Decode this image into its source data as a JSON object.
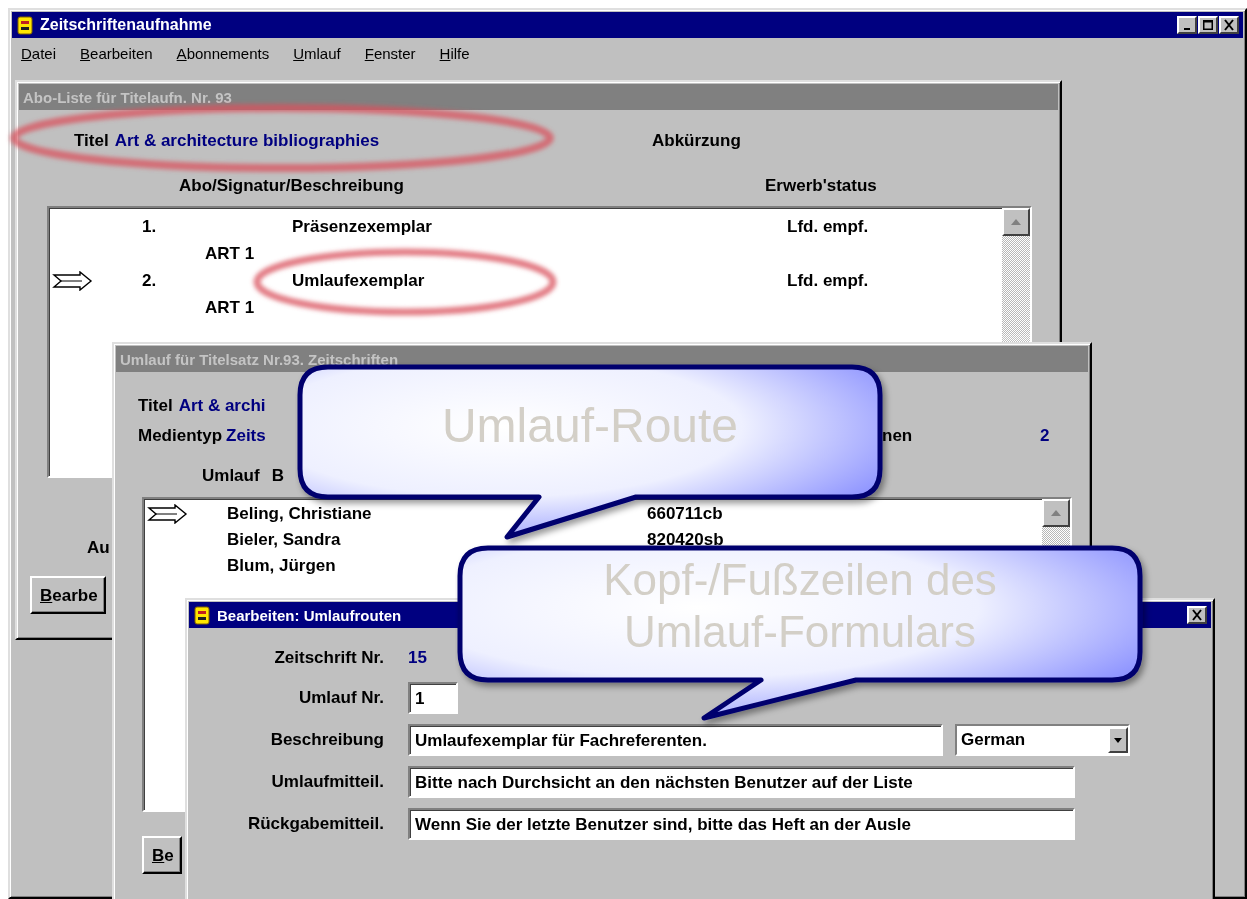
{
  "app": {
    "title": "Zeitschriftenaufnahme",
    "menu": [
      {
        "label": "Datei"
      },
      {
        "label": "Bearbeiten"
      },
      {
        "label": "Abonnements"
      },
      {
        "label": "Umlauf"
      },
      {
        "label": "Fenster"
      },
      {
        "label": "Hilfe"
      }
    ]
  },
  "abo_list_window": {
    "title": "Abo-Liste für Titelaufn. Nr. 93",
    "active": false,
    "title_label": "Titel",
    "title_value": "Art & architecture bibliographies",
    "abbreviation_label": "Abkürzung",
    "columns": [
      "Abo/Signatur/Beschreibung",
      "Erwerb'status"
    ],
    "rows": [
      {
        "number": "1.",
        "description": "Präsenzexemplar",
        "signature": "ART 1",
        "status": "Lfd. empf.",
        "selected": false
      },
      {
        "number": "2.",
        "description": "Umlaufexemplar",
        "signature": "ART 1",
        "status": "Lfd. empf.",
        "selected": true
      }
    ],
    "label_3": "Au",
    "button": "Bearbe"
  },
  "circulation_window": {
    "title": "Umlauf für Titelsatz Nr.93. Zeitschriften",
    "active": false,
    "title_label": "Titel",
    "title_value": "Art & archi",
    "media_label": "Medientyp",
    "media_value": "Zeits",
    "count_label": "nen",
    "count_value": "2",
    "columns": [
      "Umlauf",
      "B"
    ],
    "rows": [
      {
        "name": "Beling, Christiane",
        "code": "660711cb",
        "selected": true
      },
      {
        "name": "Bieler, Sandra",
        "code": "820420sb",
        "selected": false
      },
      {
        "name": "Blum, Jürgen",
        "selected": false
      }
    ],
    "button": "Be"
  },
  "edit_dialog": {
    "title": "Bearbeiten: Umlaufrouten",
    "active": true,
    "fields": [
      {
        "kind": "readout",
        "label": "Zeitschrift Nr.",
        "value": "15"
      },
      {
        "kind": "short",
        "label": "Umlauf Nr.",
        "value": "1"
      },
      {
        "kind": "dropdown",
        "label": "Beschreibung",
        "value": "Umlaufexemplar für Fachreferenten.",
        "option": "German"
      },
      {
        "kind": "long",
        "label": "Umlaufmitteil.",
        "value": "Bitte nach Durchsicht an den nächsten Benutzer auf der Liste"
      },
      {
        "kind": "long",
        "label": "Rückgabemitteil.",
        "value": "Wenn Sie der letzte Benutzer sind, bitte das Heft an der Ausle"
      }
    ]
  },
  "callouts": [
    {
      "text": "Umlauf-Route"
    },
    {
      "text": "Kopf-/Fußzeilen des Umlauf-Formulars"
    }
  ]
}
